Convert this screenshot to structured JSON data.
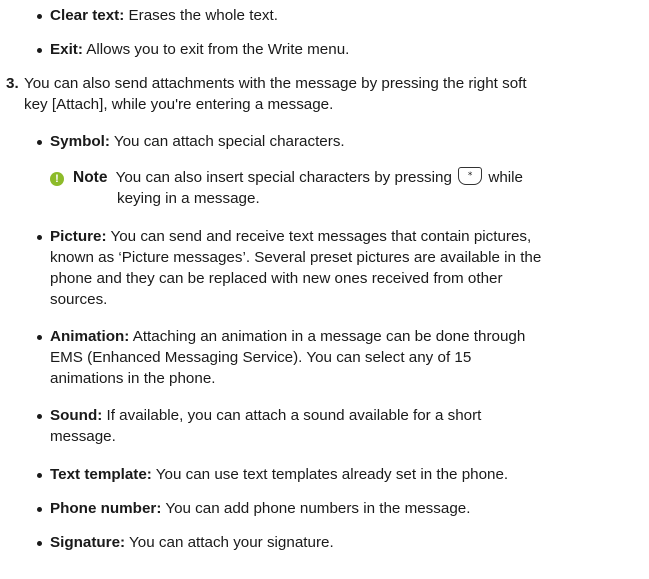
{
  "items": {
    "clear_text": {
      "term": "Clear text:",
      "desc": " Erases the whole text."
    },
    "exit": {
      "term": "Exit:",
      "desc": " Allows you to exit from the Write menu."
    },
    "step3": {
      "num": "3.",
      "line1": "You can also send attachments with the message by pressing the right soft",
      "line2": "key [Attach], while you're entering a message."
    },
    "symbol": {
      "term": "Symbol:",
      "desc": " You can attach special characters."
    },
    "note": {
      "label": "Note",
      "line1a": "You can also insert special characters by pressing",
      "key_glyph": "*",
      "line1b": "while",
      "line2": "keying in a message."
    },
    "picture": {
      "term": "Picture:",
      "line1": " You can send and receive text messages that contain pictures,",
      "line2": "known as ‘Picture messages’. Several preset pictures are available in the",
      "line3": "phone and they can be replaced with new ones received from other",
      "line4": "sources."
    },
    "animation": {
      "term": "Animation:",
      "line1": " Attaching an animation in a message can be done through",
      "line2": "EMS (Enhanced Messaging Service). You can select any of 15",
      "line3": "animations in the phone."
    },
    "sound": {
      "term": "Sound:",
      "line1": " If available, you can attach a sound available for a short",
      "line2": "message."
    },
    "text_template": {
      "term": "Text template:",
      "desc": " You can use text templates already set in the phone."
    },
    "phone_number": {
      "term": "Phone number:",
      "desc": " You can add phone numbers in the message."
    },
    "signature": {
      "term": "Signature:",
      "desc": " You can attach your signature."
    }
  },
  "colors": {
    "note_icon": "#8dbb2a",
    "text": "#1a1a1a"
  },
  "icons": {
    "note": "info-circle-icon",
    "key": "star-key-icon"
  }
}
